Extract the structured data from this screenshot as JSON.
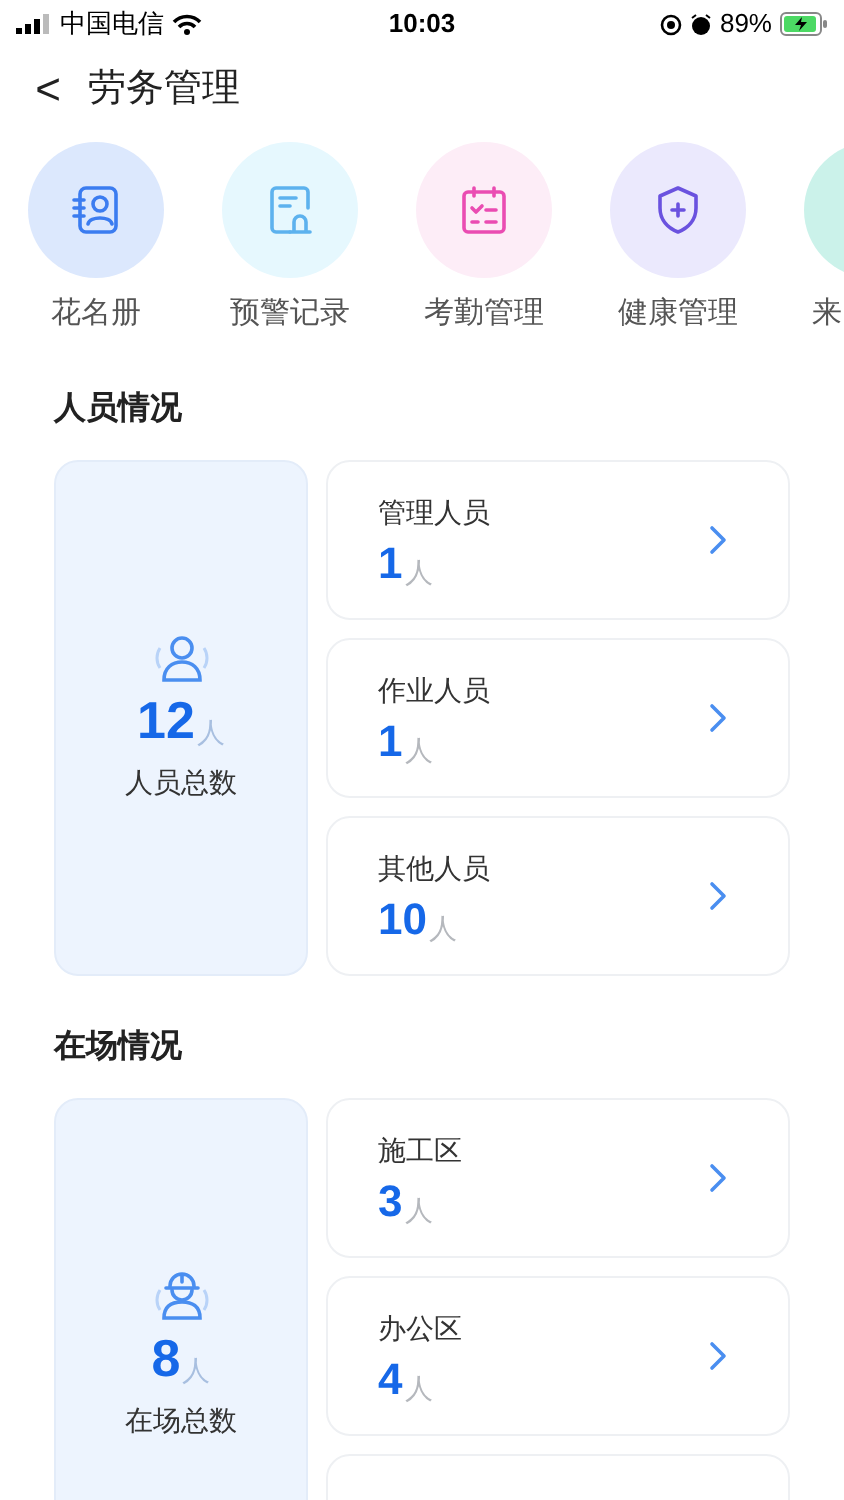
{
  "status_bar": {
    "carrier": "中国电信",
    "time": "10:03",
    "battery": "89%"
  },
  "header": {
    "back": "<",
    "title": "劳务管理"
  },
  "shortcuts": [
    {
      "kind": "roster",
      "label": "花名册"
    },
    {
      "kind": "warning",
      "label": "预警记录"
    },
    {
      "kind": "attendance",
      "label": "考勤管理"
    },
    {
      "kind": "health",
      "label": "健康管理"
    },
    {
      "kind": "other",
      "label": "来"
    }
  ],
  "sections": [
    {
      "title": "人员情况",
      "summary": {
        "kind": "people",
        "count": "12",
        "unit": "人",
        "label": "人员总数"
      },
      "cards": [
        {
          "kind": "count",
          "label": "管理人员",
          "count": "1",
          "unit": "人"
        },
        {
          "kind": "count",
          "label": "作业人员",
          "count": "1",
          "unit": "人"
        },
        {
          "kind": "count",
          "label": "其他人员",
          "count": "10",
          "unit": "人"
        }
      ]
    },
    {
      "title": "在场情况",
      "summary": {
        "kind": "worker",
        "count": "8",
        "unit": "人",
        "label": "在场总数"
      },
      "cards": [
        {
          "kind": "count",
          "label": "施工区",
          "count": "3",
          "unit": "人"
        },
        {
          "kind": "count",
          "label": "办公区",
          "count": "4",
          "unit": "人"
        },
        {
          "kind": "cut_off"
        }
      ]
    }
  ]
}
